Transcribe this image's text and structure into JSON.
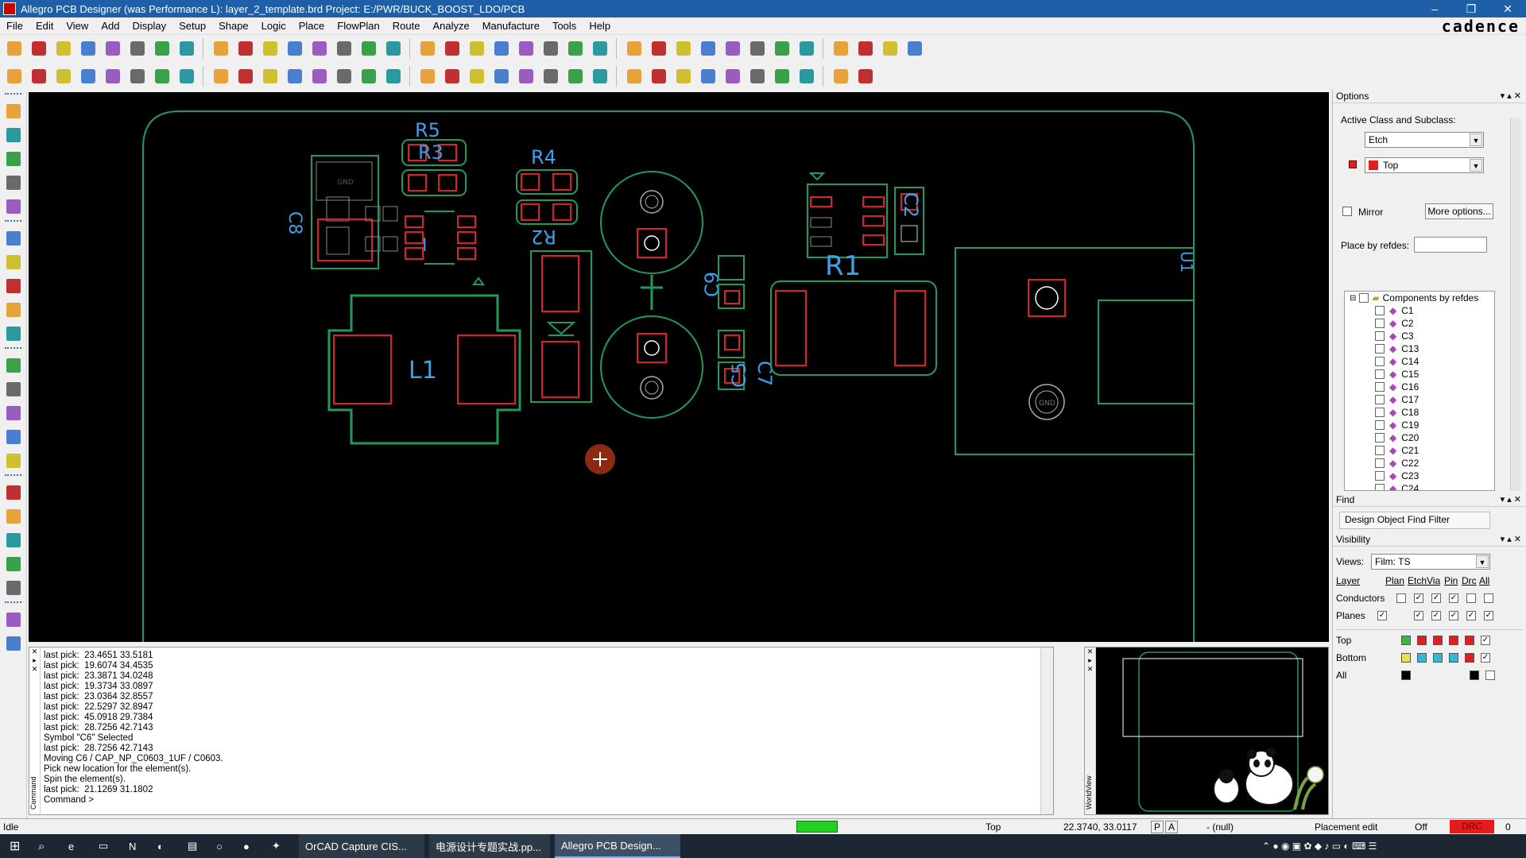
{
  "window": {
    "title": "Allegro PCB Designer (was Performance L): layer_2_template.brd  Project: E:/PWR/BUCK_BOOST_LDO/PCB",
    "controls": [
      "–",
      "❐",
      "✕"
    ]
  },
  "menu": {
    "items": [
      "File",
      "Edit",
      "View",
      "Add",
      "Display",
      "Setup",
      "Shape",
      "Logic",
      "Place",
      "FlowPlan",
      "Route",
      "Analyze",
      "Manufacture",
      "Tools",
      "Help"
    ],
    "brand": "cadence"
  },
  "board": {
    "ref_labels": {
      "r5": "R5",
      "r3": "R3",
      "r4": "R4",
      "r2": "R2",
      "r1": "R1",
      "l1": "L1",
      "c8": "C8",
      "c9": "C9",
      "c7": "C7",
      "c5": "C5",
      "c2": "C2",
      "u1": "U1",
      "gnd1": "GND",
      "gnd2": "GND"
    },
    "colors": {
      "outline": "#1e9a5c",
      "pad": "#e02020",
      "text": "#3aa0e8",
      "bg": "#000000"
    }
  },
  "options": {
    "header": "Options",
    "active_class_label": "Active Class and Subclass:",
    "class_value": "Etch",
    "subclass_value": "Top",
    "mirror_label": "Mirror",
    "more_options": "More options...",
    "place_by_refdes_label": "Place by refdes:",
    "tree_root": "Components by refdes",
    "components": [
      "C1",
      "C2",
      "C3",
      "C13",
      "C14",
      "C15",
      "C16",
      "C17",
      "C18",
      "C19",
      "C20",
      "C21",
      "C22",
      "C23",
      "C24"
    ]
  },
  "find": {
    "header": "Find",
    "filter_label": "Design Object Find Filter"
  },
  "visibility": {
    "header": "Visibility",
    "views_label": "Views:",
    "views_value": "Film: TS",
    "col_layer": "Layer",
    "cols": [
      "Plan",
      "Etch",
      "Via",
      "Pin",
      "Drc",
      "All"
    ],
    "rows": [
      {
        "name": "Conductors"
      },
      {
        "name": "Planes"
      }
    ],
    "layers": [
      {
        "name": "Top",
        "color": "#e02020",
        "alt": "#39b54a"
      },
      {
        "name": "Bottom",
        "color": "#38b6d8",
        "alt": "#e8e050"
      },
      {
        "name": "All",
        "color": "#000000"
      }
    ]
  },
  "command": {
    "lines": [
      "last pick:  23.4651 33.5181",
      "last pick:  19.6074 34.4535",
      "last pick:  23.3871 34.0248",
      "last pick:  19.3734 33.0897",
      "last pick:  23.0364 32.8557",
      "last pick:  22.5297 32.8947",
      "last pick:  45.0918 29.7384",
      "last pick:  28.7256 42.7143",
      "Symbol \"C6\" Selected",
      "last pick:  28.7256 42.7143",
      "Moving C6 / CAP_NP_C0603_1UF / C0603.",
      "Pick new location for the element(s).",
      "Spin the element(s).",
      "last pick:  21.1269 31.1802",
      "Command >"
    ],
    "side_label": "Command",
    "world_label": "WorldView"
  },
  "status": {
    "state": "Idle",
    "layer": "Top",
    "coords": "22.3740, 33.0117",
    "p": "P",
    "a": "A",
    "null": "- (null)",
    "mode": "Placement edit",
    "off": "Off",
    "drc": "DRC",
    "count": "0"
  },
  "taskbar": {
    "tasks": [
      "OrCAD Capture CIS...",
      "电源设计专题实战.pp...",
      "Allegro PCB Design..."
    ]
  }
}
